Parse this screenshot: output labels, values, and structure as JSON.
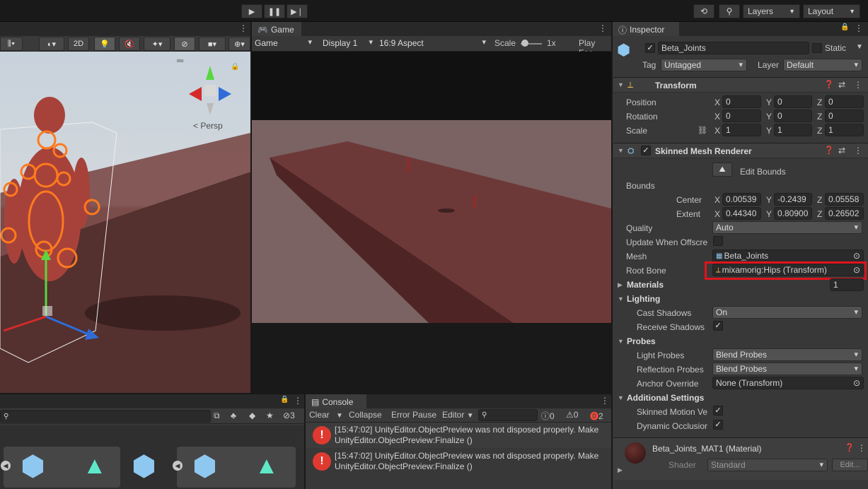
{
  "toolbar": {
    "history_icon": "history-icon",
    "search_icon": "search-icon",
    "layers": "Layers",
    "layout": "Layout"
  },
  "scene": {
    "btn_2d": "2D",
    "persp": "Persp"
  },
  "game": {
    "tab": "Game",
    "mode": "Game",
    "display": "Display 1",
    "aspect": "16:9 Aspect",
    "scale_label": "Scale",
    "scale_value": "1x",
    "play_focused": "Play Foc"
  },
  "inspector": {
    "tab": "Inspector",
    "object_name": "Beta_Joints",
    "static_label": "Static",
    "tag_label": "Tag",
    "tag_value": "Untagged",
    "layer_label": "Layer",
    "layer_value": "Default",
    "transform": {
      "title": "Transform",
      "position_label": "Position",
      "rotation_label": "Rotation",
      "scale_label": "Scale",
      "axes": [
        "X",
        "Y",
        "Z"
      ],
      "position": [
        "0",
        "0",
        "0"
      ],
      "rotation": [
        "0",
        "0",
        "0"
      ],
      "scale": [
        "1",
        "1",
        "1"
      ]
    },
    "smr": {
      "title": "Skinned Mesh Renderer",
      "edit_bounds": "Edit Bounds",
      "bounds_label": "Bounds",
      "center_label": "Center",
      "extent_label": "Extent",
      "center": [
        "0.00539",
        "-0.2439",
        "0.05558"
      ],
      "extent": [
        "0.44340",
        "0.80900",
        "0.26502"
      ],
      "quality_label": "Quality",
      "quality": "Auto",
      "update_offscreen_label": "Update When Offscre",
      "mesh_label": "Mesh",
      "mesh": "Beta_Joints",
      "root_bone_label": "Root Bone",
      "root_bone": "mixamorig:Hips (Transform)",
      "materials_label": "Materials",
      "materials_count": "1",
      "lighting_label": "Lighting",
      "cast_shadows_label": "Cast Shadows",
      "cast_shadows": "On",
      "receive_shadows_label": "Receive Shadows",
      "probes_label": "Probes",
      "light_probes_label": "Light Probes",
      "light_probes": "Blend Probes",
      "reflection_probes_label": "Reflection Probes",
      "reflection_probes": "Blend Probes",
      "anchor_override_label": "Anchor Override",
      "anchor_override": "None (Transform)",
      "additional_label": "Additional Settings",
      "skinned_motion_label": "Skinned Motion Ve",
      "dynamic_occlusion_label": "Dynamic Occlusior"
    },
    "material": {
      "name": "Beta_Joints_MAT1 (Material)",
      "shader_label": "Shader",
      "shader": "Standard",
      "edit": "Edit..."
    }
  },
  "project": {
    "count": "3"
  },
  "console": {
    "tab": "Console",
    "clear": "Clear",
    "collapse": "Collapse",
    "error_pause": "Error Pause",
    "editor": "Editor",
    "log_count": "0",
    "warn_count": "0",
    "error_count": "2",
    "messages": [
      {
        "line1": "[15:47:02] UnityEditor.ObjectPreview was not disposed properly. Make",
        "line2": "UnityEditor.ObjectPreview:Finalize ()"
      },
      {
        "line1": "[15:47:02] UnityEditor.ObjectPreview was not disposed properly. Make",
        "line2": "UnityEditor.ObjectPreview:Finalize ()"
      }
    ]
  }
}
